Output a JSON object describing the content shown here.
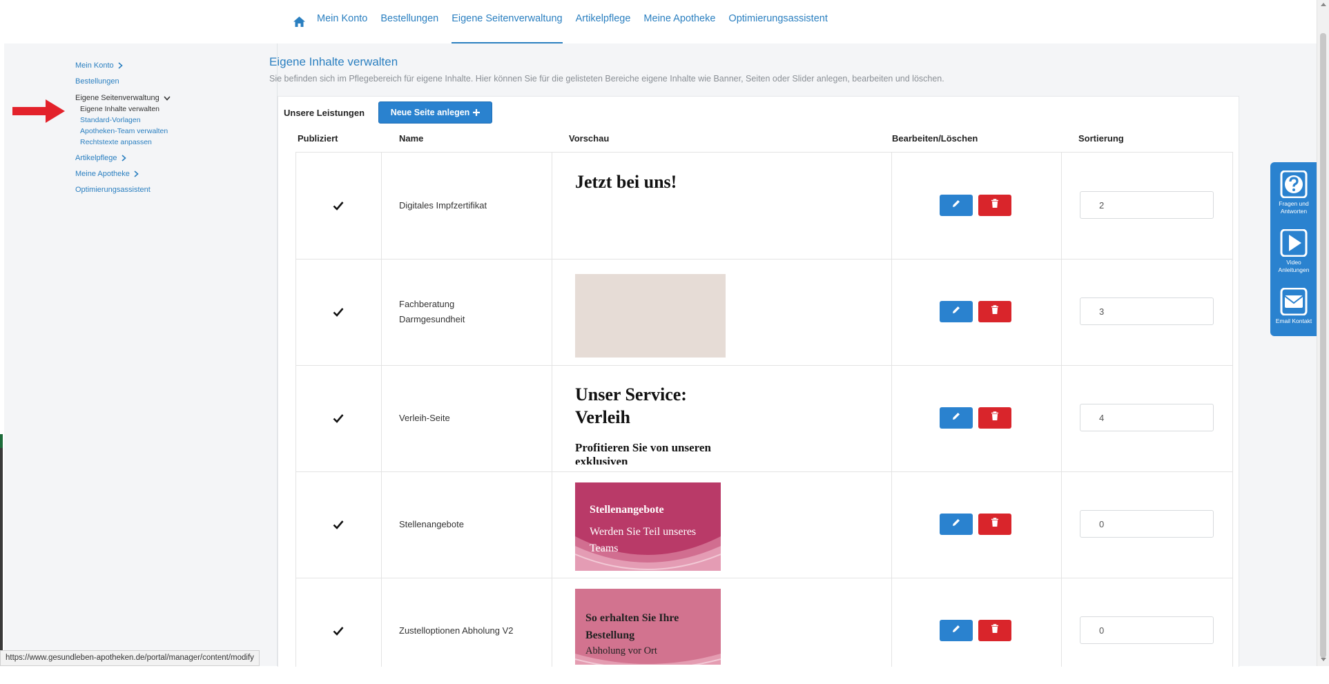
{
  "topnav": {
    "items": [
      {
        "label": "Mein Konto"
      },
      {
        "label": "Bestellungen"
      },
      {
        "label": "Eigene Seitenverwaltung"
      },
      {
        "label": "Artikelpflege"
      },
      {
        "label": "Meine Apotheke"
      },
      {
        "label": "Optimierungsassistent"
      }
    ],
    "active": "Eigene Seitenverwaltung"
  },
  "sidebar": {
    "mein_konto": "Mein Konto",
    "bestellungen": "Bestellungen",
    "eigene_seitenverwaltung": "Eigene Seitenverwaltung",
    "sub": [
      "Eigene Inhalte verwalten",
      "Standard-Vorlagen",
      "Apotheken-Team verwalten",
      "Rechtstexte anpassen"
    ],
    "artikelpflege": "Artikelpflege",
    "meine_apotheke": "Meine Apotheke",
    "optimierungsassistent": "Optimierungsassistent"
  },
  "main": {
    "title": "Eigene Inhalte verwalten",
    "description": "Sie befinden sich im Pflegebereich für eigene Inhalte. Hier können Sie für die gelisteten Bereiche eigene Inhalte wie Banner, Seiten oder Slider anlegen, bearbeiten und löschen."
  },
  "section": {
    "title": "Unsere Leistungen",
    "new_button": "Neue Seite anlegen"
  },
  "table": {
    "headers": {
      "published": "Publiziert",
      "name": "Name",
      "preview": "Vorschau",
      "edit_delete": "Bearbeiten/Löschen",
      "sort": "Sortierung"
    },
    "rows": [
      {
        "name": "Digitales Impfzertifikat",
        "sort": "2",
        "preview_title": "Jetzt bei uns!"
      },
      {
        "name_line1": "Fachberatung",
        "name_line2": "Darmgesundheit",
        "sort": "3"
      },
      {
        "name": "Verleih-Seite",
        "sort": "4",
        "preview_line1": "Unser Service:",
        "preview_line2": "Verleih",
        "preview_sub": "Profitieren Sie von unseren exklusiven"
      },
      {
        "name": "Stellenangebote",
        "sort": "0",
        "preview_title": "Stellenangebote",
        "preview_text": "Werden Sie Teil unseres Teams"
      },
      {
        "name": "Zustelloptionen Abholung V2",
        "sort": "0",
        "preview_title": "So erhalten Sie Ihre Bestellung",
        "preview_text": "Abholung vor Ort"
      }
    ]
  },
  "help": {
    "faq": "Fragen und Antworten",
    "video": "Video Anleitungen",
    "email": "Email Kontakt"
  },
  "status_url": "https://www.gesundleben-apotheken.de/portal/manager/content/modify",
  "colors": {
    "primary": "#2a82cf",
    "danger": "#d9252b",
    "link": "#2a7fc0",
    "arrow": "#e3222b"
  }
}
